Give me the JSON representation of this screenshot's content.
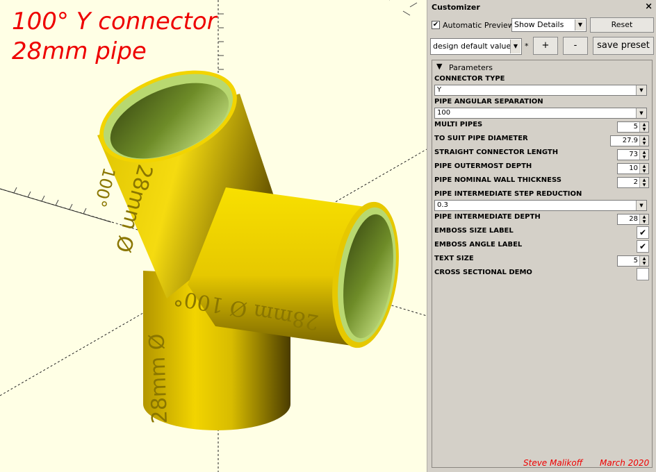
{
  "viewport": {
    "title_line1": "100° Y connector",
    "title_line2": "28mm pipe",
    "model_color": "#f2d400",
    "inner_color": "#a8c85a",
    "emboss_texts": [
      "28mm Ø",
      "100°",
      "28mm Ø 100°",
      "28mm Ø"
    ]
  },
  "customizer": {
    "title": "Customizer",
    "close_glyph": "×",
    "automatic_preview_label": "Automatic Preview",
    "automatic_preview_checked": "✔",
    "details_select": "Show Details",
    "reset_label": "Reset",
    "preset_select": "design default values",
    "preset_star": "*",
    "add_label": "+",
    "remove_label": "-",
    "save_preset_label": "save preset",
    "section_label": "Parameters",
    "section_icon": "triangle-down-icon"
  },
  "parameters": {
    "connector_type": {
      "label": "CONNECTOR TYPE",
      "value": "Y"
    },
    "pipe_angular_separation": {
      "label": "PIPE ANGULAR SEPARATION",
      "value": "100"
    },
    "multi_pipes": {
      "label": "MULTI PIPES",
      "value": "5"
    },
    "to_suit_pipe_diameter": {
      "label": "TO SUIT PIPE DIAMETER",
      "value": "27.9"
    },
    "straight_connector_length": {
      "label": "STRAIGHT CONNECTOR LENGTH",
      "value": "73"
    },
    "pipe_outermost_depth": {
      "label": "PIPE OUTERMOST DEPTH",
      "value": "10"
    },
    "pipe_nominal_wall_thickness": {
      "label": "PIPE NOMINAL WALL THICKNESS",
      "value": "2"
    },
    "pipe_intermediate_step_reduction": {
      "label": "PIPE INTERMEDIATE STEP REDUCTION",
      "value": "0.3"
    },
    "pipe_intermediate_depth": {
      "label": "PIPE INTERMEDIATE DEPTH",
      "value": "28"
    },
    "emboss_size_label": {
      "label": "EMBOSS SIZE LABEL",
      "checked": "✔"
    },
    "emboss_angle_label": {
      "label": "EMBOSS ANGLE LABEL",
      "checked": "✔"
    },
    "text_size": {
      "label": "TEXT SIZE",
      "value": "5"
    },
    "cross_sectional_demo": {
      "label": "CROSS SECTIONAL DEMO",
      "checked": ""
    }
  },
  "footer": {
    "author": "Steve Malikoff",
    "date": "March 2020"
  }
}
